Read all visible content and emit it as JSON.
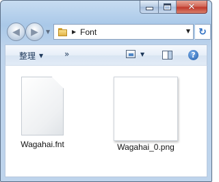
{
  "window": {
    "caption": {
      "minimize": "minimize",
      "maximize": "maximize",
      "close": "close"
    }
  },
  "address": {
    "path": [
      "Font"
    ]
  },
  "toolbar": {
    "organize_label": "整理",
    "more_label": "»"
  },
  "files": [
    {
      "name": "Wagahai.fnt",
      "icon": "generic-file-icon"
    },
    {
      "name": "Wagahai_0.png",
      "icon": "image-thumbnail"
    }
  ]
}
